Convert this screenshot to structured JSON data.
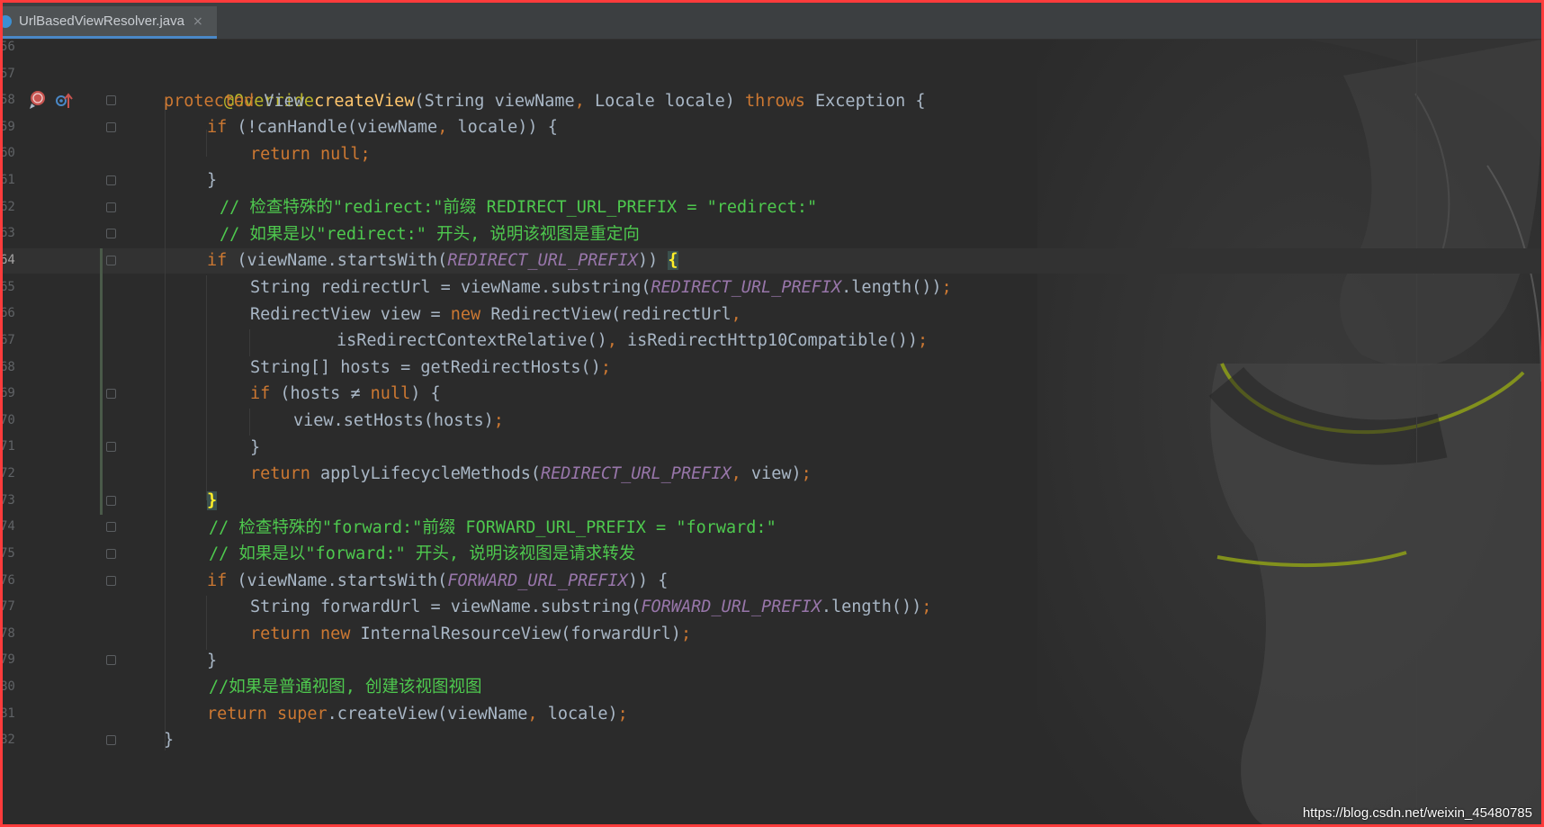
{
  "tab": {
    "file_name": "UrlBasedViewResolver.java",
    "close_glyph": "×"
  },
  "gutter": {
    "line_numbers": [
      "56",
      "57",
      "58",
      "59",
      "60",
      "61",
      "62",
      "63",
      "64",
      "65",
      "66",
      "67",
      "68",
      "69",
      "70",
      "71",
      "72",
      "73",
      "74",
      "75",
      "76",
      "77",
      "78",
      "79",
      "80",
      "81",
      "82"
    ],
    "current_line": "64"
  },
  "code": {
    "l57": "@Override",
    "l58_kw": "protected",
    "l58_type": " View ",
    "l58_fn": "createView",
    "l58_a": "(String viewName",
    "l58_comma": ",",
    "l58_b": " Locale locale) ",
    "l58_throws": "throws",
    "l58_c": " Exception {",
    "l59_kw": "if",
    "l59_a": " (!canHandle(viewName",
    "l59_comma": ",",
    "l59_b": " locale)) {",
    "l60": "return null;",
    "l61": "}",
    "l62": "// 检查特殊的\"redirect:\"前缀 REDIRECT_URL_PREFIX = \"redirect:\"",
    "l63": "// 如果是以\"redirect:\" 开头, 说明该视图是重定向",
    "l64_kw": "if",
    "l64_a": " (viewName.startsWith(",
    "l64_const": "REDIRECT_URL_PREFIX",
    "l64_b": ")) ",
    "l64_brace": "{",
    "l65_a": "String redirectUrl = viewName.substring(",
    "l65_const": "REDIRECT_URL_PREFIX",
    "l65_b": ".length())",
    "l65_semi": ";",
    "l66_a": "RedirectView view = ",
    "l66_new": "new",
    "l66_b": " RedirectView(redirectUrl",
    "l66_comma": ",",
    "l67_a": "isRedirectContextRelative()",
    "l67_comma": ",",
    "l67_b": " isRedirectHttp10Compatible())",
    "l67_semi": ";",
    "l68_a": "String[] hosts = getRedirectHosts()",
    "l68_semi": ";",
    "l69_kw": "if",
    "l69_a": " (hosts ≠ ",
    "l69_null": "null",
    "l69_b": ") {",
    "l70_a": "view.setHosts(hosts)",
    "l70_semi": ";",
    "l71": "}",
    "l72_kw": "return",
    "l72_a": " applyLifecycleMethods(",
    "l72_const": "REDIRECT_URL_PREFIX",
    "l72_comma": ",",
    "l72_b": " view)",
    "l72_semi": ";",
    "l73": "}",
    "l74": "// 检查特殊的\"forward:\"前缀 FORWARD_URL_PREFIX = \"forward:\"",
    "l75": "// 如果是以\"forward:\" 开头, 说明该视图是请求转发",
    "l76_kw": "if",
    "l76_a": " (viewName.startsWith(",
    "l76_const": "FORWARD_URL_PREFIX",
    "l76_b": ")) {",
    "l77_a": "String forwardUrl = viewName.substring(",
    "l77_const": "FORWARD_URL_PREFIX",
    "l77_b": ".length())",
    "l77_semi": ";",
    "l78_kw": "return new",
    "l78_a": " InternalResourceView(forwardUrl)",
    "l78_semi": ";",
    "l79": "}",
    "l80": "//如果是普通视图, 创建该视图视图",
    "l81_kw": "return super",
    "l81_a": ".createView(viewName",
    "l81_comma": ",",
    "l81_b": " locale)",
    "l81_semi": ";",
    "l82": "}"
  },
  "watermark": "https://blog.csdn.net/weixin_45480785",
  "colors": {
    "editor_bg": "#2b2b2b",
    "keyword": "#cc7832",
    "annotation": "#bbb529",
    "method_decl": "#ffc66d",
    "constant": "#9876aa",
    "comment": "#4ec94e",
    "frame": "#ff3b3b"
  }
}
